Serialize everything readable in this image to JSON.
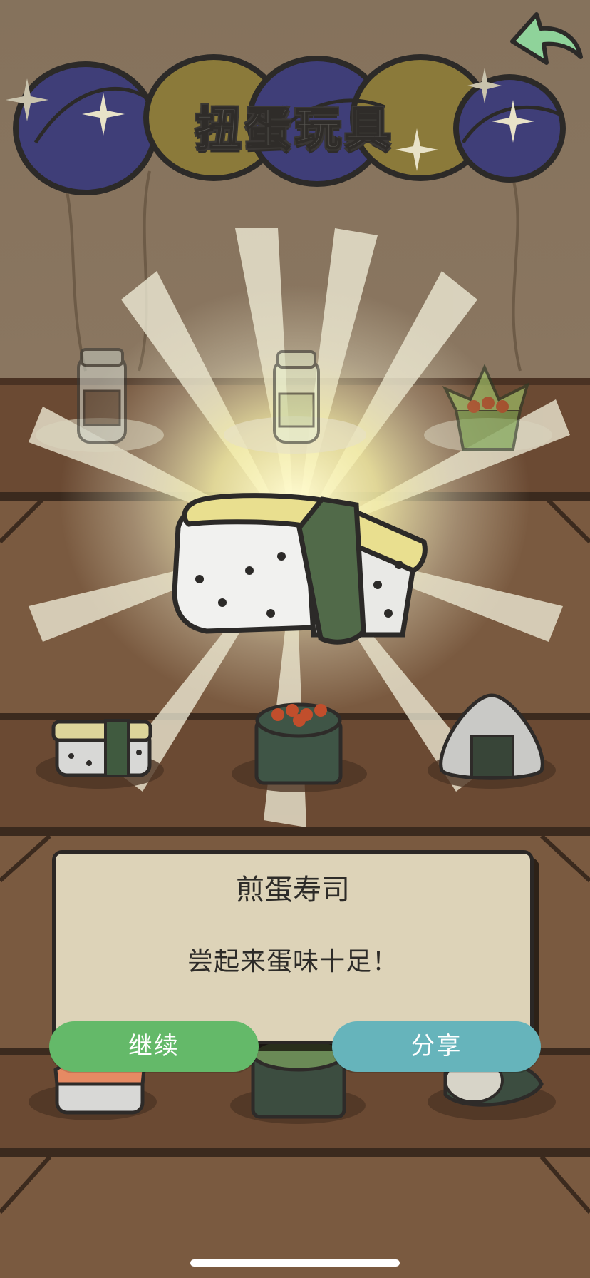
{
  "header": {
    "title": "扭蛋玩具"
  },
  "reward": {
    "item_name": "煎蛋寿司",
    "item_description": "尝起来蛋味十足！",
    "continue_label": "继续",
    "share_label": "分享"
  },
  "colors": {
    "continue_button": "#64b969",
    "share_button": "#66b4bb",
    "dialog_bg": "#ddd3b8",
    "back_arrow": "#8fd39a"
  },
  "icons": {
    "back": "back-arrow-icon",
    "featured_item": "tamago-sushi-icon"
  }
}
